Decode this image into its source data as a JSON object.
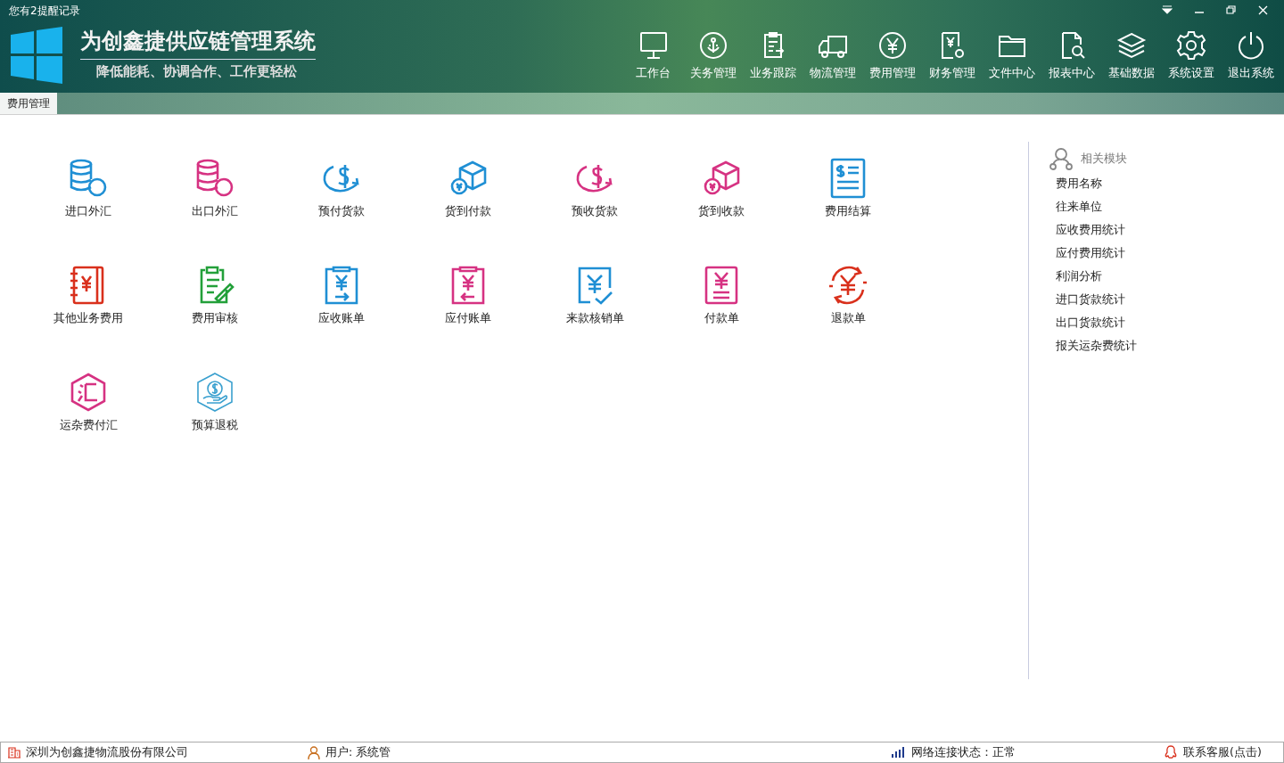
{
  "window": {
    "notice": "您有2提醒记录"
  },
  "brand": {
    "title": "为创鑫捷供应链管理系统",
    "slogan": "降低能耗、协调合作、工作更轻松"
  },
  "nav": [
    {
      "label": "工作台",
      "kind": "monitor"
    },
    {
      "label": "关务管理",
      "kind": "anchor"
    },
    {
      "label": "业务跟踪",
      "kind": "clipboard"
    },
    {
      "label": "物流管理",
      "kind": "truck"
    },
    {
      "label": "费用管理",
      "kind": "yen"
    },
    {
      "label": "财务管理",
      "kind": "yendoc"
    },
    {
      "label": "文件中心",
      "kind": "folder"
    },
    {
      "label": "报表中心",
      "kind": "report"
    },
    {
      "label": "基础数据",
      "kind": "layers"
    },
    {
      "label": "系统设置",
      "kind": "gear"
    },
    {
      "label": "退出系统",
      "kind": "power"
    }
  ],
  "tabs": [
    {
      "label": "费用管理",
      "selected": true
    }
  ],
  "modules": [
    {
      "label": "进口外汇",
      "kind": "coins",
      "color": "#1f8fd4"
    },
    {
      "label": "出口外汇",
      "kind": "coins",
      "color": "#d63282"
    },
    {
      "label": "预付货款",
      "kind": "dollar",
      "color": "#1f8fd4"
    },
    {
      "label": "货到付款",
      "kind": "box",
      "color": "#1f8fd4"
    },
    {
      "label": "预收货款",
      "kind": "dollar",
      "color": "#d63282"
    },
    {
      "label": "货到收款",
      "kind": "box",
      "color": "#d63282"
    },
    {
      "label": "费用结算",
      "kind": "bill",
      "color": "#1f8fd4"
    },
    {
      "label": "其他业务费用",
      "kind": "notebook",
      "color": "#d9301c"
    },
    {
      "label": "费用审核",
      "kind": "audit",
      "color": "#23a03a"
    },
    {
      "label": "应收账单",
      "kind": "in",
      "color": "#1f8fd4"
    },
    {
      "label": "应付账单",
      "kind": "out",
      "color": "#d63282"
    },
    {
      "label": "来款核销单",
      "kind": "check",
      "color": "#1f8fd4"
    },
    {
      "label": "付款单",
      "kind": "pay",
      "color": "#d63282"
    },
    {
      "label": "退款单",
      "kind": "refund",
      "color": "#d9301c"
    },
    {
      "label": "运杂费付汇",
      "kind": "hex",
      "color": "#d63282"
    },
    {
      "label": "预算退税",
      "kind": "hexdollar",
      "color": "#3aa0cf"
    }
  ],
  "related": {
    "title": "相关模块",
    "items": [
      "费用名称",
      "往来单位",
      "应收费用统计",
      "应付费用统计",
      "利润分析",
      "进口货款统计",
      "出口货款统计",
      "报关运杂费统计"
    ]
  },
  "status_bar": {
    "company": "深圳为创鑫捷物流股份有限公司",
    "user": "用户: 系统管",
    "network": "网络连接状态：正常",
    "support": "联系客服(点击)"
  }
}
